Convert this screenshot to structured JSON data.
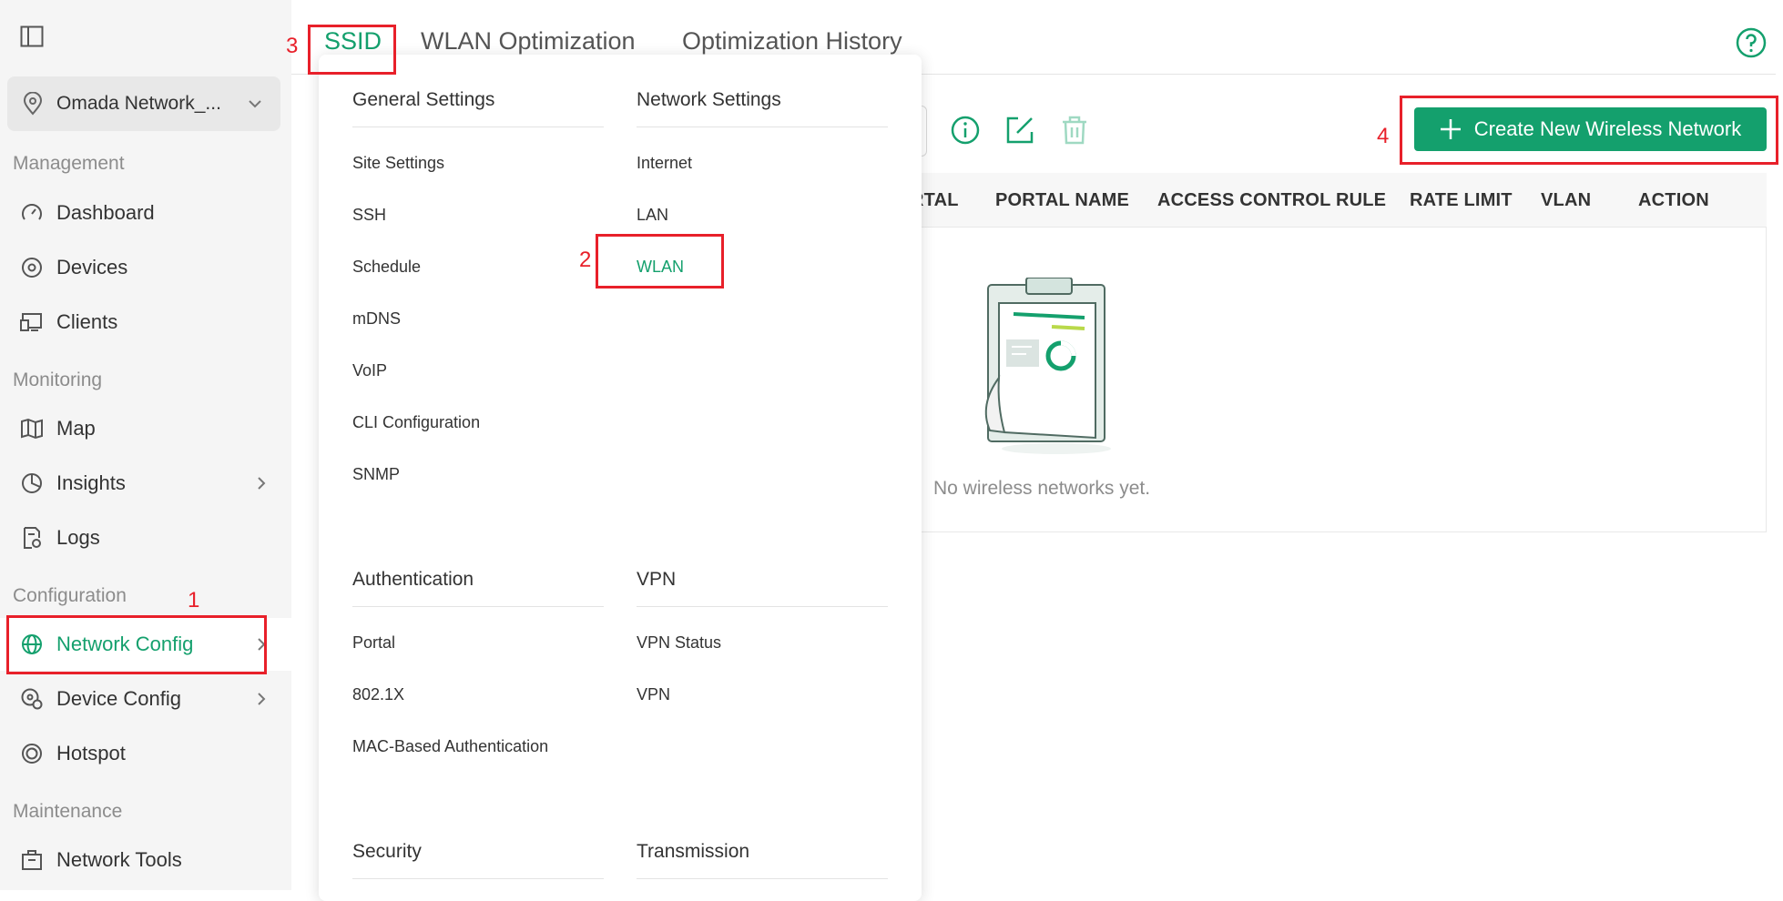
{
  "sidebar": {
    "site_name": "Omada Network_...",
    "sections": {
      "management": "Management",
      "monitoring": "Monitoring",
      "configuration": "Configuration",
      "maintenance": "Maintenance"
    },
    "items": {
      "dashboard": "Dashboard",
      "devices": "Devices",
      "clients": "Clients",
      "map": "Map",
      "insights": "Insights",
      "logs": "Logs",
      "network_config": "Network Config",
      "device_config": "Device Config",
      "hotspot": "Hotspot",
      "network_tools": "Network Tools"
    }
  },
  "tabs": {
    "ssid": "SSID",
    "wlan_optimization": "WLAN Optimization",
    "optimization_history": "Optimization History"
  },
  "annotations": {
    "n1": "1",
    "n2": "2",
    "n3": "3",
    "n4": "4"
  },
  "toolbar": {
    "create_button": "Create New Wireless Network"
  },
  "table": {
    "headers": {
      "portal": "RTAL",
      "portal_name": "PORTAL NAME",
      "acl": "ACCESS CONTROL RULE",
      "rate_limit": "RATE LIMIT",
      "vlan": "VLAN",
      "action": "ACTION"
    },
    "empty_text": "No wireless networks yet."
  },
  "menu": {
    "general": {
      "title": "General Settings",
      "items": [
        "Site Settings",
        "SSH",
        "Schedule",
        "mDNS",
        "VoIP",
        "CLI Configuration",
        "SNMP"
      ]
    },
    "network": {
      "title": "Network Settings",
      "items": [
        "Internet",
        "LAN",
        "WLAN"
      ]
    },
    "authentication": {
      "title": "Authentication",
      "items": [
        "Portal",
        "802.1X",
        "MAC-Based Authentication"
      ]
    },
    "vpn": {
      "title": "VPN",
      "items": [
        "VPN Status",
        "VPN"
      ]
    },
    "security": {
      "title": "Security"
    },
    "transmission": {
      "title": "Transmission"
    }
  },
  "colors": {
    "accent": "#14a06d",
    "annotation": "#e8202a"
  }
}
